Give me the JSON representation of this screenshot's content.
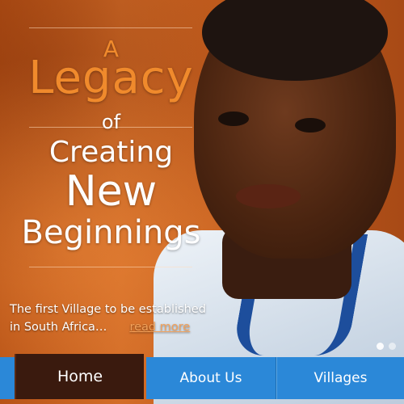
{
  "hero": {
    "line_a": "A",
    "line_legacy": "Legacy",
    "line_of": "of",
    "line_creating": "Creating",
    "line_new": "New",
    "line_beginnings": "Beginnings",
    "tagline": "The first Village to be established in South Africa…",
    "read_more": "read more",
    "accent_color": "#f08a2c",
    "slider_dots": 2
  },
  "nav": {
    "items": [
      {
        "label": "Home",
        "active": true
      },
      {
        "label": "About Us",
        "active": false
      },
      {
        "label": "Villages",
        "active": false
      }
    ],
    "bar_color": "#2b88d8",
    "active_color": "#3a1a0e"
  }
}
